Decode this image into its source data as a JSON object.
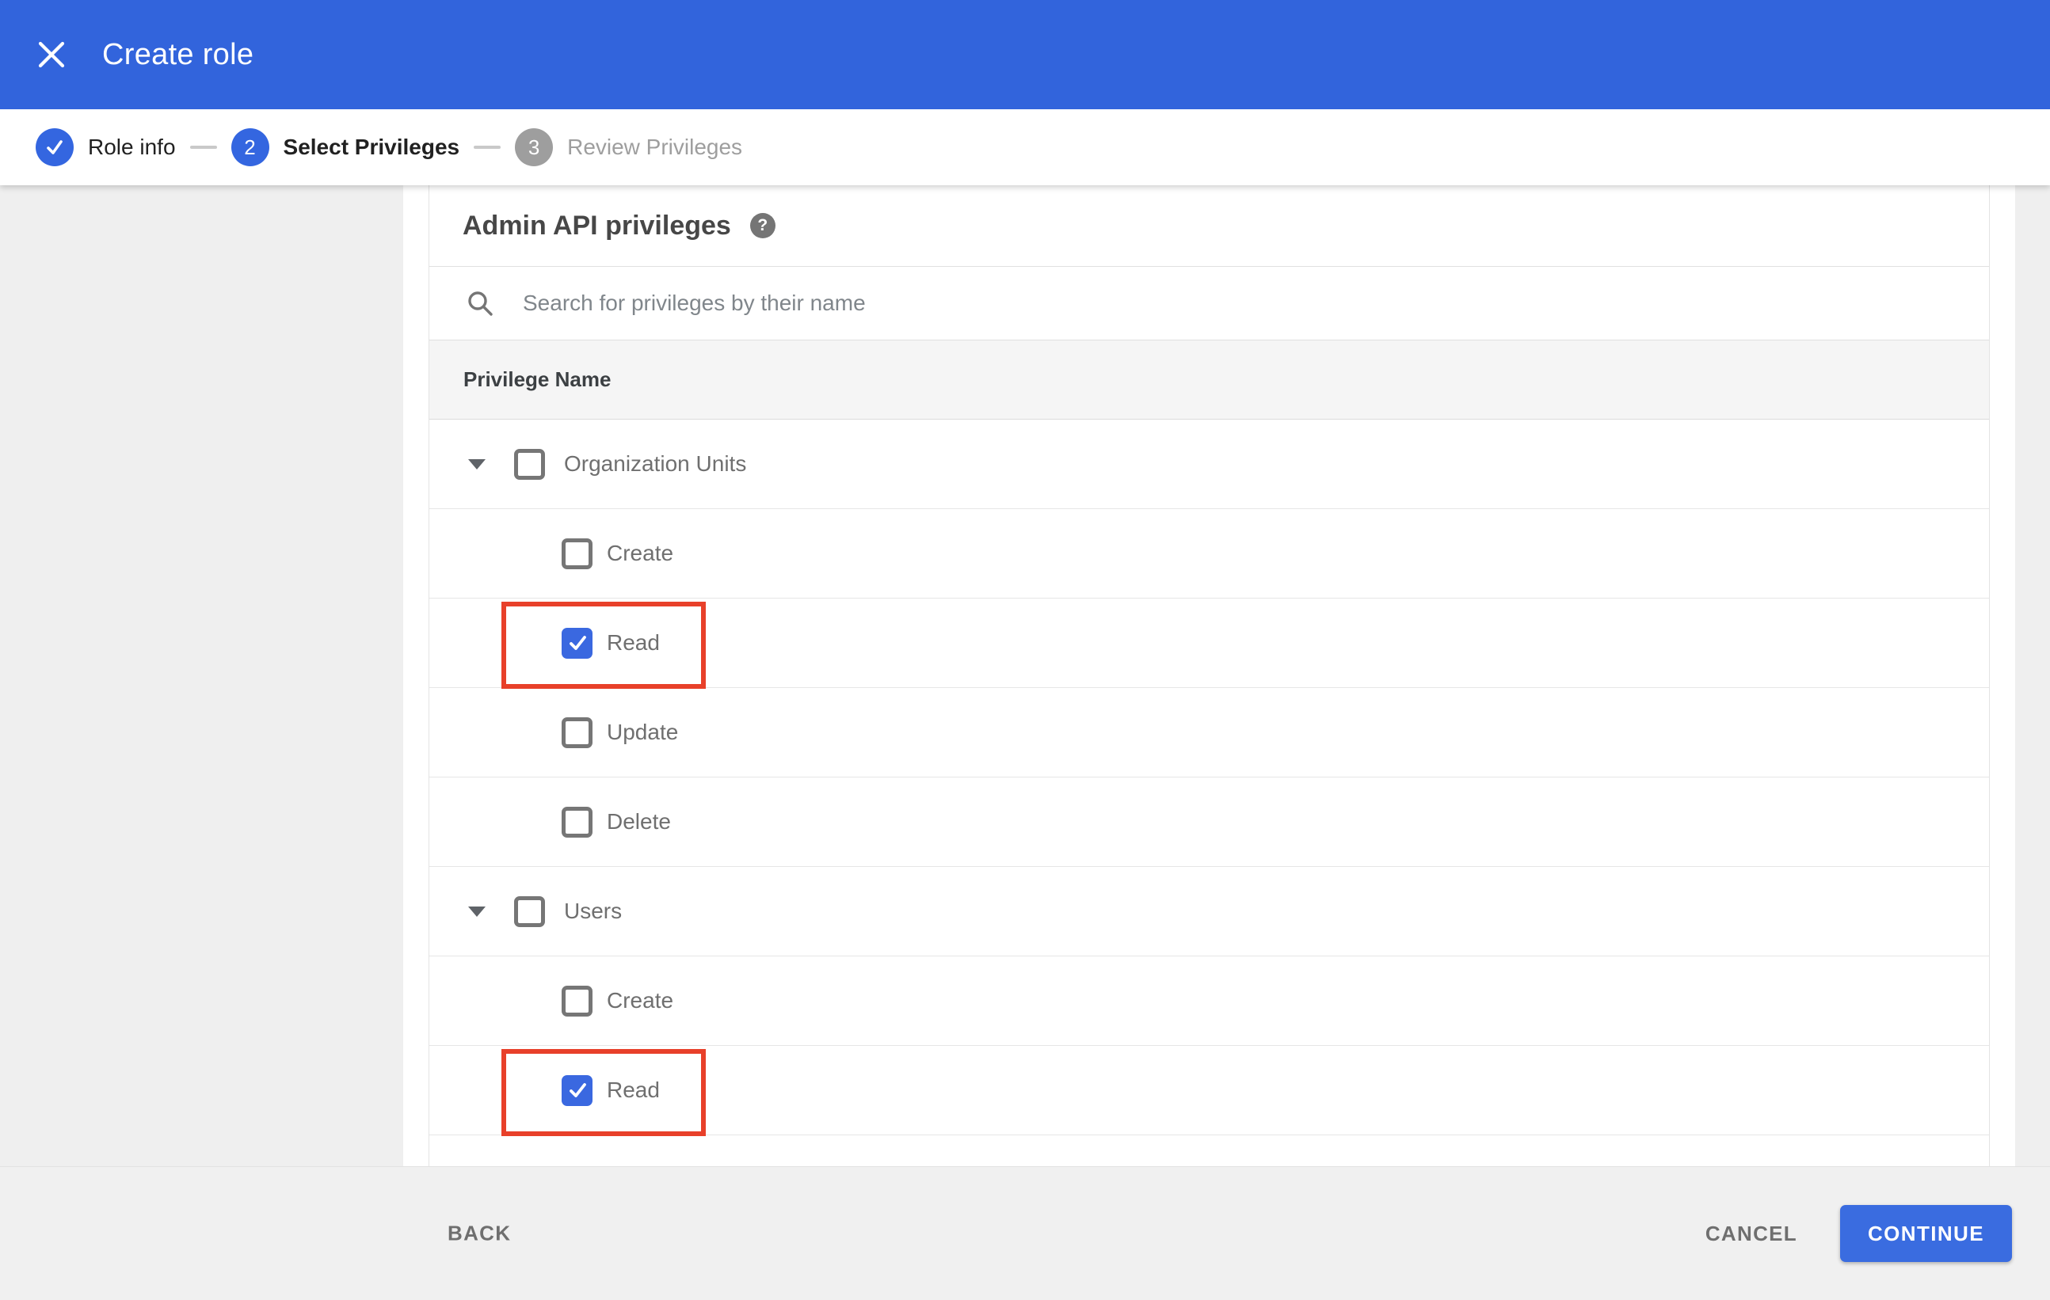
{
  "window": {
    "title": "Create role"
  },
  "stepper": {
    "steps": [
      {
        "label": "Role info",
        "state": "completed",
        "number": ""
      },
      {
        "label": "Select Privileges",
        "state": "active",
        "number": "2"
      },
      {
        "label": "Review Privileges",
        "state": "upcoming",
        "number": "3"
      }
    ]
  },
  "privileges": {
    "section_title": "Admin API privileges",
    "search_placeholder": "Search for privileges by their name",
    "column_header": "Privilege Name",
    "groups": [
      {
        "label": "Organization Units",
        "checked": false,
        "children": [
          {
            "label": "Create",
            "checked": false,
            "highlighted": false
          },
          {
            "label": "Read",
            "checked": true,
            "highlighted": true
          },
          {
            "label": "Update",
            "checked": false,
            "highlighted": false
          },
          {
            "label": "Delete",
            "checked": false,
            "highlighted": false
          }
        ]
      },
      {
        "label": "Users",
        "checked": false,
        "children": [
          {
            "label": "Create",
            "checked": false,
            "highlighted": false
          },
          {
            "label": "Read",
            "checked": true,
            "highlighted": true
          }
        ]
      }
    ]
  },
  "footer": {
    "back_label": "BACK",
    "cancel_label": "CANCEL",
    "continue_label": "CONTINUE"
  },
  "icons": {
    "help_glyph": "?"
  },
  "colors": {
    "header_blue": "#3264dc",
    "step_blue": "#3466e0",
    "step_gray": "#9e9e9e",
    "checkbox_blue": "#3a68e0",
    "continue_blue": "#3a6ce0",
    "annotation_red": "#e8402a",
    "table_header_bg": "#f5f5f5",
    "surround_gray": "#efefef",
    "footer_gray": "#f0f0f0"
  }
}
